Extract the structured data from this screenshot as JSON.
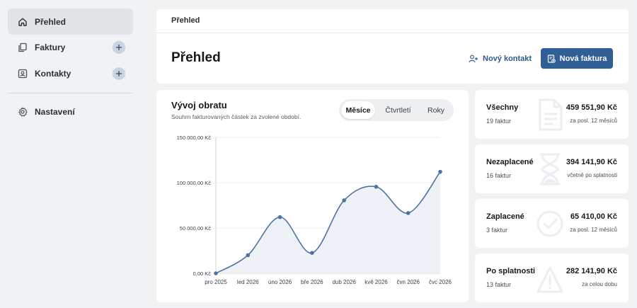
{
  "sidebar": {
    "items": [
      {
        "label": "Přehled",
        "icon": "home-icon"
      },
      {
        "label": "Faktury",
        "icon": "documents-icon"
      },
      {
        "label": "Kontakty",
        "icon": "contact-card-icon"
      },
      {
        "label": "Nastavení",
        "icon": "gear-icon"
      }
    ]
  },
  "header": {
    "breadcrumb": "Přehled",
    "title": "Přehled",
    "new_contact": "Nový kontakt",
    "new_invoice": "Nová faktura"
  },
  "chart_card": {
    "title": "Vývoj obratu",
    "subtitle": "Souhrn fakturovaných částek za zvolené období.",
    "segments": [
      "Měsíce",
      "Čtvrtletí",
      "Roky"
    ],
    "selected_segment": "Měsíce"
  },
  "chart_data": {
    "type": "area",
    "categories": [
      "pro 2025",
      "led 2026",
      "úno 2026",
      "bře 2026",
      "dub 2026",
      "kvě 2026",
      "čvn 2026",
      "čvc 2026"
    ],
    "values": [
      0,
      20000,
      62000,
      22500,
      80500,
      95500,
      66500,
      112000
    ],
    "y_ticks": [
      0,
      50000,
      100000,
      150000
    ],
    "y_tick_labels": [
      "0,00 Kč",
      "50 000,00 Kč",
      "100 000,00 Kč",
      "150 000,00 Kč"
    ],
    "ylim": [
      0,
      150000
    ],
    "grid": true,
    "line_color": "#4b74a3",
    "fill_color": "#eef1f6"
  },
  "stats": [
    {
      "label": "Všechny",
      "count": "19 faktur",
      "value": "459 551,90 Kč",
      "note": "za posl. 12 měsíců",
      "icon": "document-icon"
    },
    {
      "label": "Nezaplacené",
      "count": "16 faktur",
      "value": "394 141,90 Kč",
      "note": "včetně po splatnosti",
      "icon": "hourglass-icon"
    },
    {
      "label": "Zaplacené",
      "count": "3 faktur",
      "value": "65 410,00 Kč",
      "note": "za posl. 12 měsíců",
      "icon": "check-circle-icon"
    },
    {
      "label": "Po splatnosti",
      "count": "13 faktur",
      "value": "282 141,90 Kč",
      "note": "za celou dobu",
      "icon": "warning-icon"
    }
  ],
  "colors": {
    "accent": "#305f97",
    "link": "#2e5b8f",
    "background": "#f1f2f4"
  }
}
